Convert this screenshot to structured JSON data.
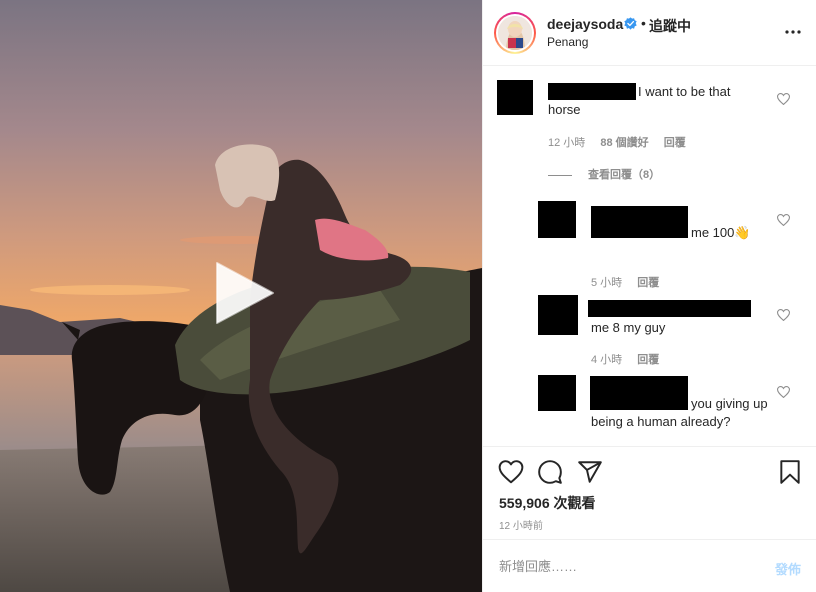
{
  "media": {
    "type": "video",
    "play_icon": "play-icon"
  },
  "header": {
    "username": "deejaysoda",
    "verified_icon": "verified-badge-icon",
    "separator": "•",
    "follow_state": "追蹤中",
    "location": "Penang",
    "more_icon": "more-options-icon"
  },
  "comments": [
    {
      "text": "I want to be that horse",
      "time": "12 小時",
      "likes": "88 個讚好",
      "reply": "回覆",
      "view_replies": "查看回覆（8）"
    },
    {
      "text": "me 100👋",
      "time": "5 小時",
      "reply": "回覆"
    },
    {
      "text": "me 8 my guy",
      "time": "4 小時",
      "reply": "回覆"
    },
    {
      "text": "you giving up being a human already?"
    }
  ],
  "actions": {
    "like_icon": "heart-icon",
    "comment_icon": "comment-icon",
    "share_icon": "share-icon",
    "save_icon": "bookmark-icon",
    "views": "559,906 次觀看",
    "time_ago": "12 小時前"
  },
  "composer": {
    "placeholder": "新增回應……",
    "post_label": "發佈",
    "post_color": "#b3dbff"
  },
  "colors": {
    "text": "#262626",
    "secondary": "#8e8e8e",
    "border": "#efefef",
    "verified": "#3897f0"
  }
}
